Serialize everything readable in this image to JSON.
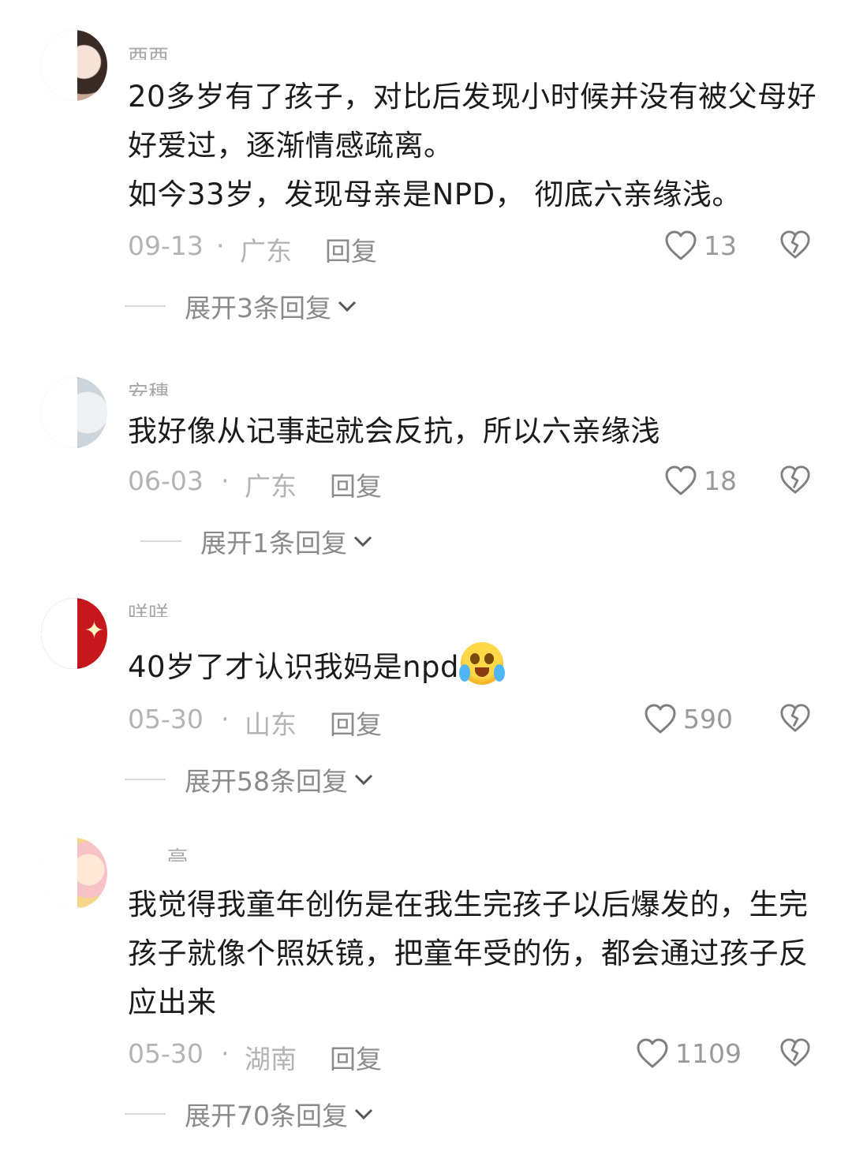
{
  "comments": [
    {
      "username": "酉酉",
      "text": "20多岁有了孩子，对比后发现小时候并没有被父母好好爱过，逐渐情感疏离。",
      "text2": "如今33岁，发现母亲是NPD， 彻底六亲缘浅。",
      "date": "09-13",
      "dot": "·",
      "region": "广东",
      "reply": "回复",
      "likes": "13",
      "expand": "展开3条回复"
    },
    {
      "username": "安穗",
      "text": "我好像从记事起就会反抗，所以六亲缘浅",
      "date": "06-03",
      "dot": "·",
      "region": "广东",
      "reply": "回复",
      "likes": "18",
      "expand": "展开1条回复"
    },
    {
      "username": "咩咩",
      "text": "40岁了才认识我妈是npd",
      "emoji": "crying-face-emoji",
      "date": "05-30",
      "dot": "·",
      "region": "山东",
      "reply": "回复",
      "likes": "590",
      "expand": "展开58条回复"
    },
    {
      "username": "亭",
      "text": "我觉得我童年创伤是在我生完孩子以后爆发的，生完孩子就像个照妖镜，把童年受的伤，都会通过孩子反应出来",
      "date": "05-30",
      "dot": "·",
      "region": "湖南",
      "reply": "回复",
      "likes": "1109",
      "expand": "展开70条回复"
    }
  ],
  "icons": {
    "like": "heart-outline-icon",
    "dislike": "broken-heart-icon",
    "expand": "chevron-down-icon"
  },
  "colors": {
    "text": "#1b1b1b",
    "meta": "#b3b3b3",
    "reply": "#8c8c8c",
    "expand": "#8a8a8a"
  }
}
